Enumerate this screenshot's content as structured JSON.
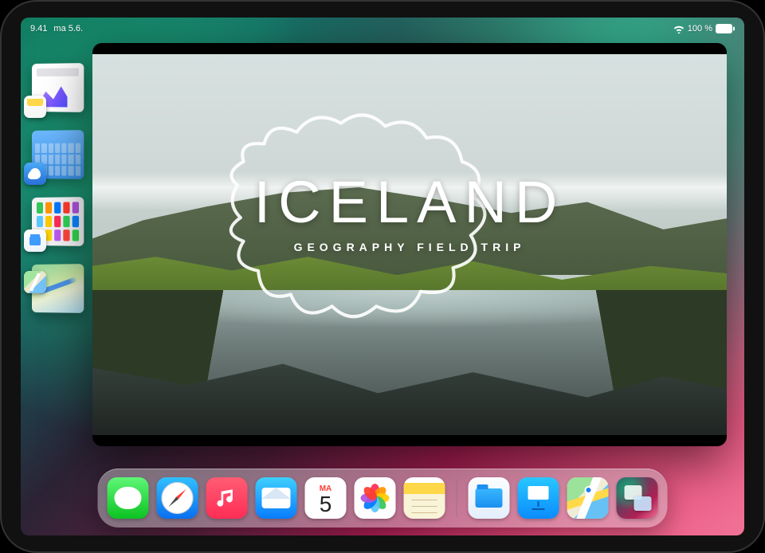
{
  "status": {
    "time": "9.41",
    "date": "ma 5.6.",
    "battery": "100 %"
  },
  "stage": {
    "items": [
      {
        "app": "Notes"
      },
      {
        "app": "Weather"
      },
      {
        "app": "Files"
      },
      {
        "app": "Maps"
      }
    ]
  },
  "slide": {
    "title": "ICELAND",
    "subtitle": "GEOGRAPHY FIELD TRIP"
  },
  "calendar": {
    "weekday": "MA",
    "day": "5"
  },
  "dock": {
    "apps": [
      "Messages",
      "Safari",
      "Music",
      "Mail",
      "Calendar",
      "Photos",
      "Notes"
    ],
    "recent": [
      "Files",
      "Keynote",
      "Maps",
      "Stage Manager"
    ]
  }
}
